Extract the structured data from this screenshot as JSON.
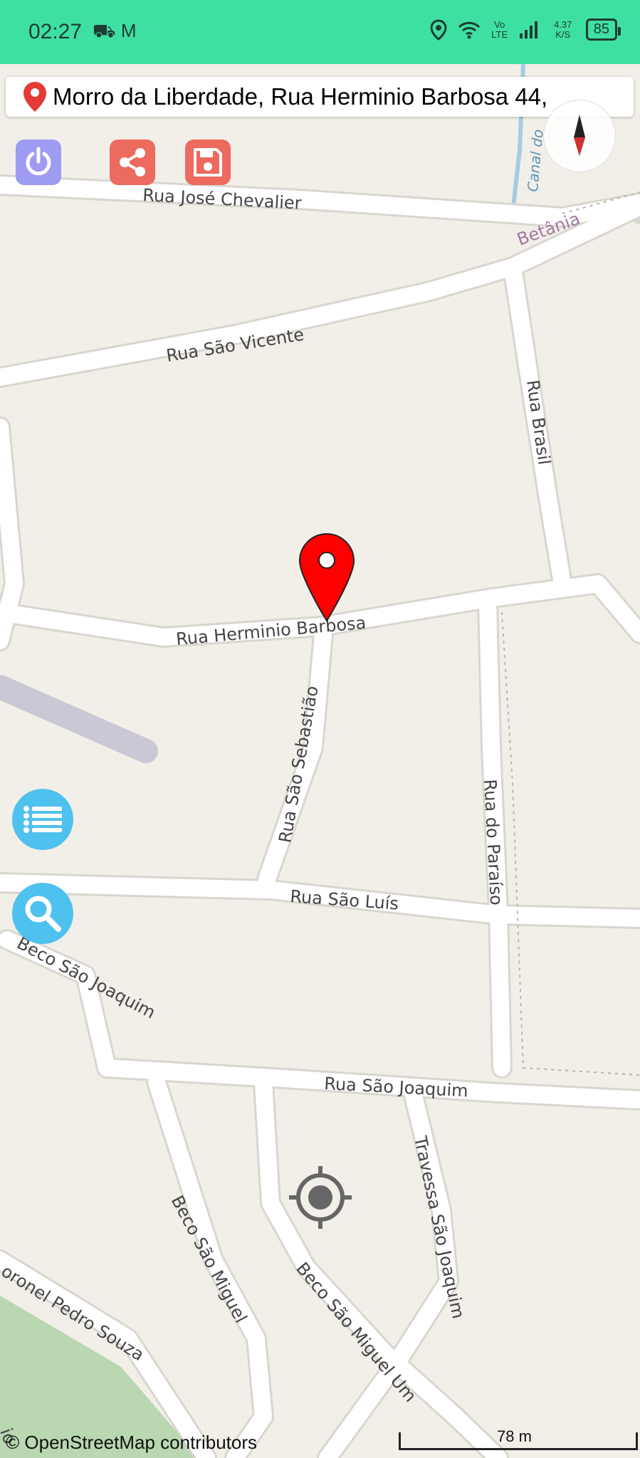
{
  "status_bar": {
    "time": "02:27",
    "app_icons": "⛟ M",
    "network_type": "Vo LTE",
    "speed": "4.37 K/S",
    "battery": "85"
  },
  "address_bar": {
    "text": "Morro da Liberdade, Rua Herminio Barbosa 44,"
  },
  "streets": {
    "jose_chevalier": "Rua José Chevalier",
    "betania": "Betânia",
    "canal": "Canal do",
    "sao_vicente": "Rua São Vicente",
    "brasil": "Rua Brasil",
    "herminio_barbosa": "Rua Herminio Barbosa",
    "sao_sebastiao": "Rua São Sebastião",
    "paraiso": "Rua do Paraíso",
    "sao_luis": "Rua São Luís",
    "beco_sao_joaquim": "Beco São Joaquim",
    "sao_joaquim": "Rua São Joaquim",
    "travessa_sao_joaquim": "Travessa São Joaquim",
    "beco_sao_miguel": "Beco São Miguel",
    "beco_sao_miguel_um": "Beco São Miguel Um",
    "coronel_pedro_souza": "oronel Pedro Souza",
    "edge_fragment": "io"
  },
  "map": {
    "attribution": "© OpenStreetMap contributors",
    "scale": "78 m"
  },
  "colors": {
    "status_bar": "#3ee0a1",
    "map_background": "#f2efe9",
    "marker": "#ff0000",
    "power_button": "#9e9bf3",
    "share_button": "#ec6a5e",
    "round_buttons": "#4fc1ee"
  },
  "icons": {
    "power": "power-icon",
    "share": "share-icon",
    "save": "save-icon",
    "list": "list-icon",
    "search": "search-icon",
    "compass": "compass-icon",
    "locate": "locate-icon",
    "marker": "map-marker-icon",
    "address_pin": "location-pin-icon"
  }
}
